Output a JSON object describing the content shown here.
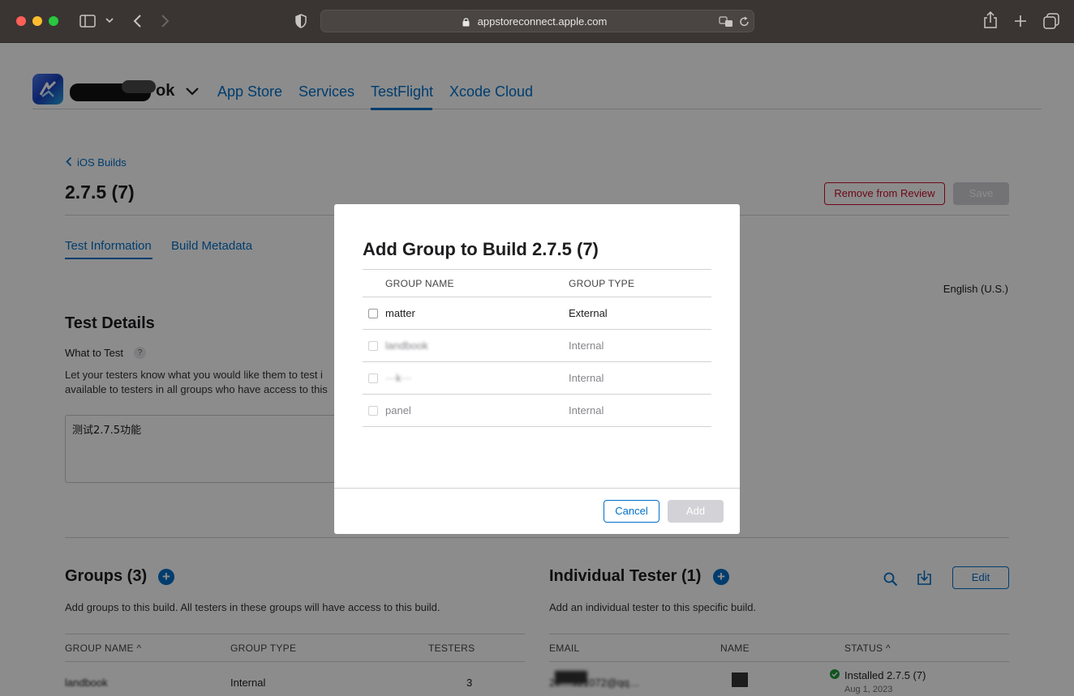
{
  "browser": {
    "url": "appstoreconnect.apple.com",
    "icons": [
      "sidebar-icon",
      "chevron-down-icon",
      "back-icon",
      "forward-icon",
      "shield-icon",
      "lock-icon",
      "translate-icon",
      "reload-icon",
      "share-icon",
      "new-tab-icon",
      "tabs-icon"
    ]
  },
  "nav": {
    "account_suffix": "ok",
    "items": [
      "App Store",
      "Services",
      "TestFlight",
      "Xcode Cloud"
    ],
    "active": "TestFlight"
  },
  "page": {
    "back_link": "iOS Builds",
    "title": "2.7.5 (7)",
    "remove_button": "Remove from Review",
    "save_button": "Save",
    "tabs": [
      "Test Information",
      "Build Metadata"
    ],
    "language": "English (U.S.)",
    "test_details_heading": "Test Details",
    "what_to_test_label": "What to Test",
    "help_glyph": "?",
    "desc_line1": "Let your testers know what you would like them to test i",
    "desc_line2": "available to testers in all groups who have access to this",
    "what_to_test_value": "测试2.7.5功能"
  },
  "groups": {
    "heading": "Groups (3)",
    "description": "Add groups to this build. All testers in these groups will have access to this build.",
    "columns": [
      "GROUP NAME",
      "GROUP TYPE",
      "TESTERS"
    ],
    "sort_glyph": "^",
    "row": {
      "name": "landbook",
      "type": "Internal",
      "testers": "3"
    }
  },
  "individual": {
    "heading": "Individual Tester (1)",
    "description": "Add an individual tester to this specific build.",
    "edit_button": "Edit",
    "columns": [
      "EMAIL",
      "NAME",
      "STATUS"
    ],
    "row": {
      "email": "2e…321072@qq…",
      "status": "Installed 2.7.5 (7)",
      "date": "Aug 1, 2023"
    }
  },
  "modal": {
    "title": "Add Group to Build 2.7.5 (7)",
    "columns": [
      "GROUP NAME",
      "GROUP TYPE"
    ],
    "rows": [
      {
        "name": "matter",
        "type": "External",
        "enabled": true
      },
      {
        "name": "landbook",
        "type": "Internal",
        "enabled": false
      },
      {
        "name": "···k···",
        "type": "Internal",
        "enabled": false
      },
      {
        "name": "panel",
        "type": "Internal",
        "enabled": false
      }
    ],
    "cancel_button": "Cancel",
    "add_button": "Add"
  },
  "colors": {
    "accent": "#0070c9",
    "destructive": "#c8102e",
    "success": "#1f9c3c"
  }
}
